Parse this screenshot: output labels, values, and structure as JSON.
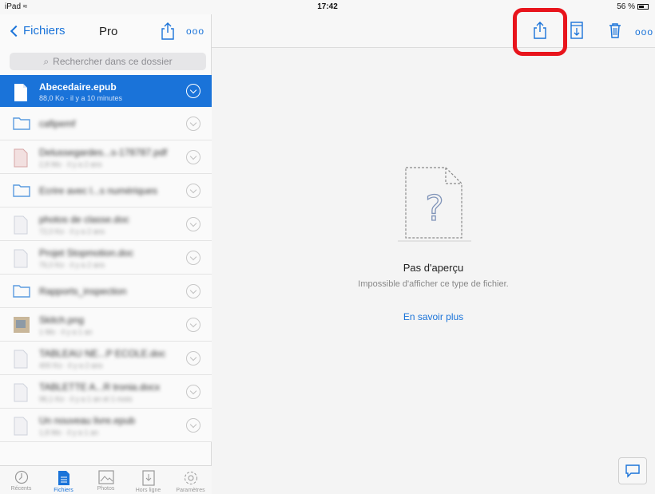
{
  "status_bar": {
    "device": "iPad",
    "time": "17:42",
    "battery": "56 %"
  },
  "sidebar": {
    "back_label": "Fichiers",
    "title": "Pro",
    "more_label": "ooo",
    "search_placeholder": "Rechercher dans ce dossier",
    "files": [
      {
        "name": "Abecedaire.epub",
        "meta": "88,0 Ko · il y a 10 minutes",
        "type": "file",
        "selected": true
      },
      {
        "name": "cafipemf",
        "meta": "",
        "type": "folder"
      },
      {
        "name": "Delussegardes...s-178787.pdf",
        "meta": "2,8 Mo · il y a 2 ans",
        "type": "pdf"
      },
      {
        "name": "Ecrire avec l...s numériques",
        "meta": "",
        "type": "folder"
      },
      {
        "name": "photos de classe.doc",
        "meta": "72,0 Ko · il y a 2 ans",
        "type": "doc"
      },
      {
        "name": "Projet Stopmotion.doc",
        "meta": "76,0 Ko · il y a 2 ans",
        "type": "doc"
      },
      {
        "name": "Rapports_inspection",
        "meta": "",
        "type": "folder"
      },
      {
        "name": "Skitch.png",
        "meta": "1 Mo · il y a 1 an",
        "type": "image"
      },
      {
        "name": "TABLEAU NE...P ECOLE.doc",
        "meta": "400 Ko · il y a 2 ans",
        "type": "doc"
      },
      {
        "name": "TABLETTE A...R tronia.docx",
        "meta": "96,1 Ko · il y a 1 an et 1 mois",
        "type": "doc"
      },
      {
        "name": "Un nouveau livre.epub",
        "meta": "1,8 Mo · il y a 1 an",
        "type": "file"
      }
    ],
    "tabs": [
      {
        "label": "Récents",
        "icon": "clock-icon"
      },
      {
        "label": "Fichiers",
        "icon": "file-icon",
        "active": true
      },
      {
        "label": "Photos",
        "icon": "photo-icon"
      },
      {
        "label": "Hors ligne",
        "icon": "offline-icon"
      },
      {
        "label": "Paramètres",
        "icon": "gear-icon"
      }
    ]
  },
  "main": {
    "more_label": "ooo",
    "preview_title": "Pas d'aperçu",
    "preview_subtitle": "Impossible d'afficher ce type de fichier.",
    "learn_more": "En savoir plus"
  },
  "colors": {
    "accent": "#1a73d9",
    "highlight": "#e8141c"
  }
}
